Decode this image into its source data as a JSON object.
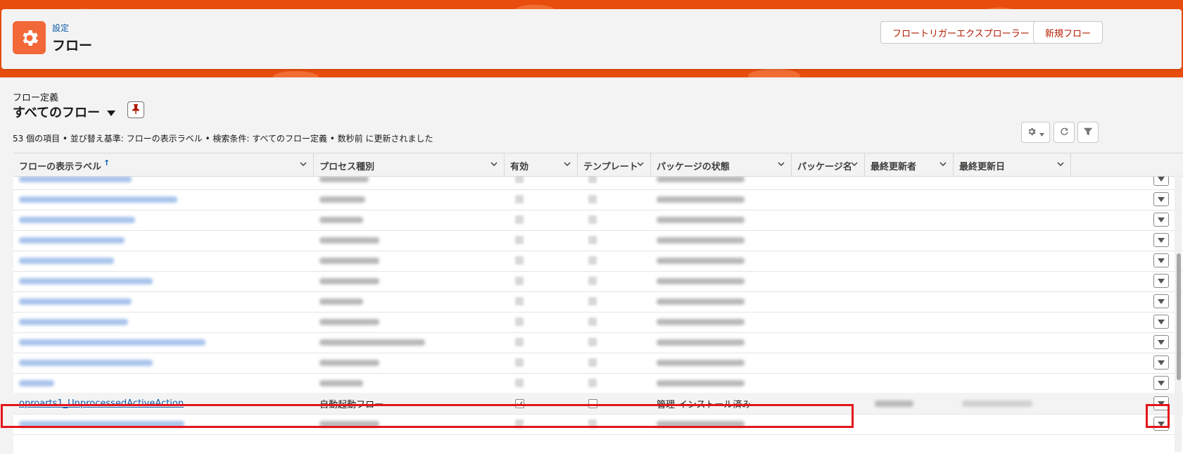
{
  "header": {
    "breadcrumb": "設定",
    "title": "フロー",
    "buttons": {
      "explorer": "フロートリガーエクスプローラー",
      "new_flow": "新規フロー"
    }
  },
  "list": {
    "object_label": "フロー定義",
    "view_name": "すべてのフロー",
    "status": "53 個の項目 • 並び替え基準: フローの表示ラベル • 検索条件: すべてのフロー定義 • 数秒前 に更新されました",
    "sort_indicator": "↑"
  },
  "columns": [
    {
      "label": "フローの表示ラベル"
    },
    {
      "label": "プロセス種別"
    },
    {
      "label": "有効"
    },
    {
      "label": "テンプレート"
    },
    {
      "label": "パッケージの状態"
    },
    {
      "label": "パッケージ名"
    },
    {
      "label": "最終更新者"
    },
    {
      "label": "最終更新日"
    }
  ],
  "highlighted_row": {
    "label": "oproarts1_UnprocessedActiveAction",
    "process_type": "自動起動フロー",
    "active": true,
    "template": false,
    "package_state": "管理-インストール済み"
  },
  "colors": {
    "brand": "#e84d0e",
    "icon_bg": "#f26838",
    "link": "#0b5cab",
    "button_text": "#b21a00",
    "highlight": "#e4141b"
  },
  "icons": {
    "app": "gear-icon",
    "pin": "pin-icon",
    "settings": "gear-icon",
    "refresh": "refresh-icon",
    "filter": "filter-icon",
    "row_action": "chevron-down-icon"
  }
}
